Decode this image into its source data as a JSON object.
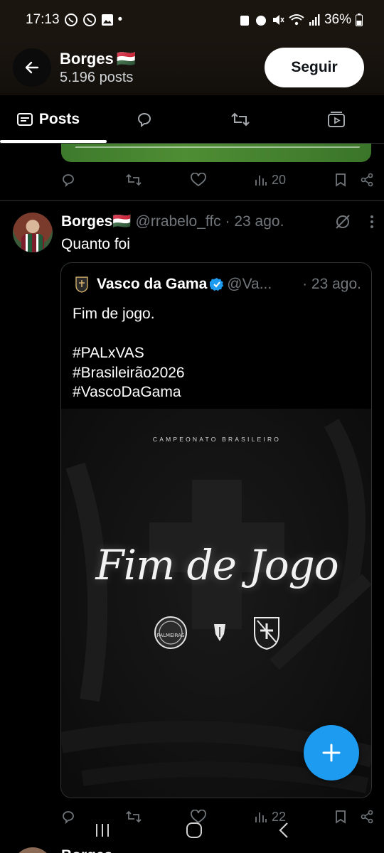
{
  "status_bar": {
    "time": "17:13",
    "battery": "36%"
  },
  "header": {
    "name": "Borges",
    "flag": "🇭🇺",
    "post_count": "5.196 posts",
    "follow_label": "Seguir"
  },
  "tabs": [
    {
      "label": "Posts",
      "icon": "posts-icon",
      "active": true
    },
    {
      "icon": "reply-icon"
    },
    {
      "icon": "repost-icon"
    },
    {
      "icon": "video-icon"
    }
  ],
  "prev_tweet": {
    "views": "20"
  },
  "tweet": {
    "name": "Borges",
    "flag": "🇭🇺",
    "handle": "@rrabelo_ffc",
    "date": "· 23 ago.",
    "text": "Quanto foi",
    "views": "22"
  },
  "quote": {
    "name": "Vasco da Gama",
    "handle": "@Va...",
    "date": "· 23 ago.",
    "text": "Fim de jogo.\n\n#PALxVAS\n#Brasileirão2026\n#VascoDaGama",
    "media": {
      "kicker": "CAMPEONATO BRASILEIRO",
      "title": "Fim de Jogo",
      "logo_left_text": "PALMEIRAS"
    }
  },
  "next_tweet": {
    "name": "Borges"
  },
  "colors": {
    "accent": "#1d9bf0",
    "muted": "#71767b",
    "divider": "#2f3336"
  }
}
